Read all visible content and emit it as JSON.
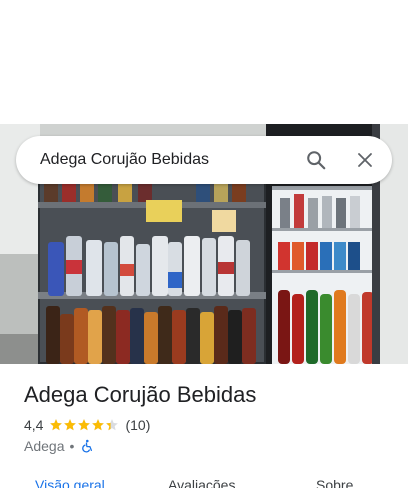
{
  "search": {
    "query": "Adega Corujão Bebidas",
    "search_icon": "search-icon",
    "close_icon": "close-icon"
  },
  "place": {
    "name": "Adega Corujão Bebidas",
    "rating": "4,4",
    "rating_value": 4.4,
    "reviews": "(10)",
    "category": "Adega",
    "separator": "•",
    "accessibility_icon": "wheelchair-icon"
  },
  "tabs": [
    {
      "label": "Visão geral"
    },
    {
      "label": "Avaliações"
    },
    {
      "label": "Sobre"
    }
  ],
  "colors": {
    "star": "#fbbc04",
    "accent": "#1a73e8",
    "active_tab": "#137333"
  }
}
